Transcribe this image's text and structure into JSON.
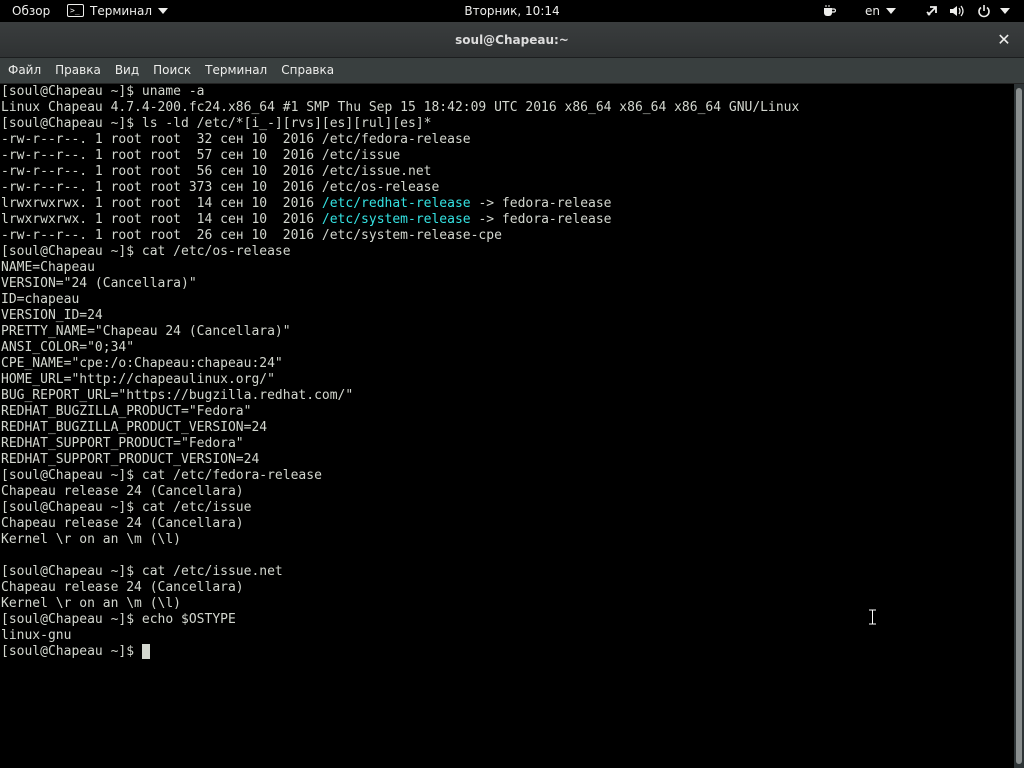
{
  "topbar": {
    "activities": "Обзор",
    "app_icon_glyph": ">_",
    "app_name": "Терминал",
    "clock": "Вторник, 10:14",
    "lang": "en"
  },
  "window": {
    "title": "soul@Chapeau:~",
    "close_glyph": "✕"
  },
  "menu": [
    "Файл",
    "Правка",
    "Вид",
    "Поиск",
    "Терминал",
    "Справка"
  ],
  "terminal": {
    "prompt": "[soul@Chapeau ~]$ ",
    "lines": [
      "[soul@Chapeau ~]$ uname -a",
      "Linux Chapeau 4.7.4-200.fc24.x86_64 #1 SMP Thu Sep 15 18:42:09 UTC 2016 x86_64 x86_64 x86_64 GNU/Linux",
      "[soul@Chapeau ~]$ ls -ld /etc/*[i_-][rvs][es][rul][es]*",
      "-rw-r--r--. 1 root root  32 сен 10  2016 /etc/fedora-release",
      "-rw-r--r--. 1 root root  57 сен 10  2016 /etc/issue",
      "-rw-r--r--. 1 root root  56 сен 10  2016 /etc/issue.net",
      "-rw-r--r--. 1 root root 373 сен 10  2016 /etc/os-release",
      {
        "pre": "lrwxrwxrwx. 1 root root  14 сен 10  2016 ",
        "link": "/etc/redhat-release",
        "post": " -> fedora-release"
      },
      {
        "pre": "lrwxrwxrwx. 1 root root  14 сен 10  2016 ",
        "link": "/etc/system-release",
        "post": " -> fedora-release"
      },
      "-rw-r--r--. 1 root root  26 сен 10  2016 /etc/system-release-cpe",
      "[soul@Chapeau ~]$ cat /etc/os-release",
      "NAME=Chapeau",
      "VERSION=\"24 (Cancellara)\"",
      "ID=chapeau",
      "VERSION_ID=24",
      "PRETTY_NAME=\"Chapeau 24 (Cancellara)\"",
      "ANSI_COLOR=\"0;34\"",
      "CPE_NAME=\"cpe:/o:Chapeau:chapeau:24\"",
      "HOME_URL=\"http://chapeaulinux.org/\"",
      "BUG_REPORT_URL=\"https://bugzilla.redhat.com/\"",
      "REDHAT_BUGZILLA_PRODUCT=\"Fedora\"",
      "REDHAT_BUGZILLA_PRODUCT_VERSION=24",
      "REDHAT_SUPPORT_PRODUCT=\"Fedora\"",
      "REDHAT_SUPPORT_PRODUCT_VERSION=24",
      "[soul@Chapeau ~]$ cat /etc/fedora-release",
      "Chapeau release 24 (Cancellara)",
      "[soul@Chapeau ~]$ cat /etc/issue",
      "Chapeau release 24 (Cancellara)",
      "Kernel \\r on an \\m (\\l)",
      "",
      "[soul@Chapeau ~]$ cat /etc/issue.net",
      "Chapeau release 24 (Cancellara)",
      "Kernel \\r on an \\m (\\l)",
      "[soul@Chapeau ~]$ echo $OSTYPE",
      "linux-gnu"
    ]
  },
  "colors": {
    "text": "#d3d7cf",
    "link": "#34e2e2",
    "background": "#000000",
    "titlebar": "#35393a",
    "menubar": "#393f3f"
  },
  "icons": {
    "tray": [
      "coffee-cup-icon",
      "network-icon",
      "volume-icon",
      "power-icon"
    ]
  }
}
